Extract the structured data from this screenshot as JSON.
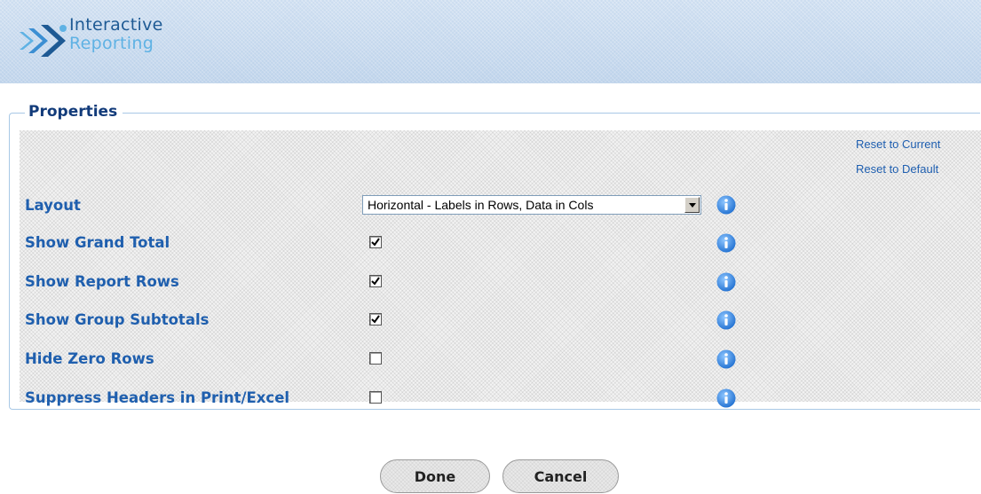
{
  "app": {
    "logo_line1": "Interactive",
    "logo_line2": "Reporting"
  },
  "panel": {
    "title": "Properties",
    "reset_current": "Reset to Current",
    "reset_default": "Reset to Default"
  },
  "properties": {
    "layout": {
      "label": "Layout",
      "value": "Horizontal - Labels in Rows, Data in Cols"
    },
    "rows": [
      {
        "label": "Show Grand Total",
        "checked": true
      },
      {
        "label": "Show Report Rows",
        "checked": true
      },
      {
        "label": "Show Group Subtotals",
        "checked": true
      },
      {
        "label": "Hide Zero Rows",
        "checked": false
      },
      {
        "label": "Suppress Headers in Print/Excel",
        "checked": false
      }
    ]
  },
  "buttons": {
    "done": "Done",
    "cancel": "Cancel"
  },
  "colors": {
    "label": "#1f5fae",
    "title": "#123b7a",
    "info": "#2f7fd8",
    "link": "#1f5fb0"
  },
  "icons": {
    "logo": "double-chevron-logo-icon",
    "info": "info-icon",
    "dropdown": "chevron-down-icon",
    "check": "checkmark-icon"
  }
}
